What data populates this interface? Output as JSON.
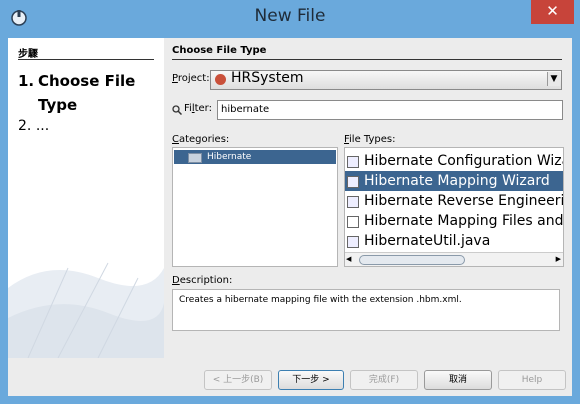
{
  "window": {
    "title": "New File",
    "close_glyph": "✕"
  },
  "steps": {
    "header": "步驟",
    "items": [
      {
        "number": "1.",
        "label_line1": "Choose File",
        "label_line2": "Type"
      },
      {
        "number": "2.",
        "label": "..."
      }
    ]
  },
  "main": {
    "section_title": "Choose File Type",
    "project_label_mnemonic": "P",
    "project_label_rest": "roject:",
    "project_value": "HRSystem",
    "filter_label_prefix": "Fi",
    "filter_label_mnemonic": "l",
    "filter_label_rest": "ter:",
    "filter_value": "hibernate",
    "categories_label_mnemonic": "C",
    "categories_label_rest": "ategories:",
    "categories": [
      {
        "label": "Hibernate",
        "selected": true
      }
    ],
    "file_types_label_mnemonic": "F",
    "file_types_label_rest": "ile Types:",
    "file_types": [
      {
        "label": "Hibernate Configuration Wizard",
        "selected": false,
        "icon": "config-file-icon"
      },
      {
        "label": "Hibernate Mapping Wizard",
        "selected": true,
        "icon": "mapping-wizard-icon"
      },
      {
        "label": "Hibernate Reverse Engineering Wizard",
        "selected": false,
        "icon": "reverse-eng-icon"
      },
      {
        "label": "Hibernate Mapping Files and POJOs from Database",
        "selected": false,
        "icon": "blank-file-icon"
      },
      {
        "label": "HibernateUtil.java",
        "selected": false,
        "icon": "java-file-icon"
      }
    ],
    "description_label_mnemonic": "D",
    "description_label_rest": "escription:",
    "description": "Creates a hibernate mapping file with the extension .hbm.xml."
  },
  "buttons": {
    "back": "< 上一步(B)",
    "next": "下一步 >",
    "finish": "完成(F)",
    "cancel": "取消",
    "help": "Help"
  },
  "colors": {
    "title_bar": "#6aa9dc",
    "selection": "#3c6590",
    "close": "#c7443a"
  }
}
